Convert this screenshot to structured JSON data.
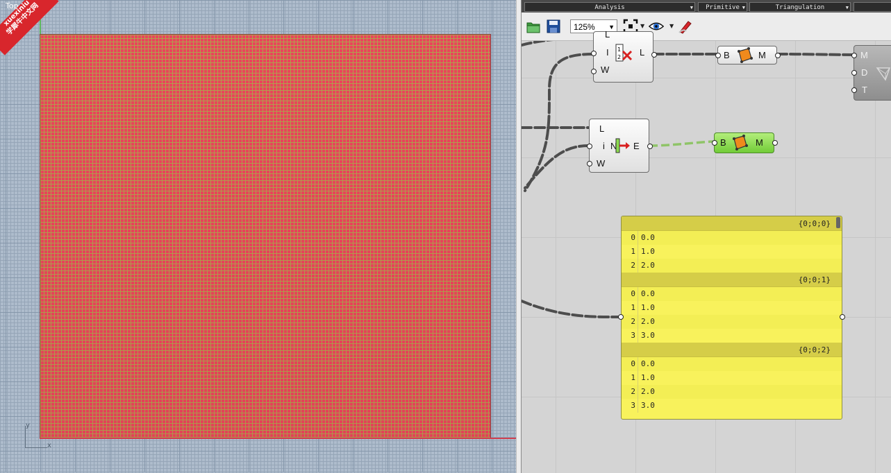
{
  "viewport": {
    "title": "Top",
    "axis_x": "x",
    "axis_y": "y",
    "watermark_line1": "xuexiniu",
    "watermark_line2": "学犀牛中文网"
  },
  "tabs": [
    {
      "label": "Analysis"
    },
    {
      "label": "Primitive"
    },
    {
      "label": "Triangulation"
    }
  ],
  "toolbar": {
    "zoom": "125%",
    "open_icon": "folder-open-icon",
    "save_icon": "save-icon",
    "zoom_extents_icon": "zoom-extents-icon",
    "preview_icon": "eye-icon",
    "sketch_icon": "pen-icon"
  },
  "components": {
    "list_item": {
      "in": [
        "L",
        "I",
        "W"
      ],
      "out": "L"
    },
    "boundary_top": {
      "in": "B",
      "out": "M"
    },
    "delaunay": {
      "in": [
        "M",
        "D",
        "T"
      ]
    },
    "member_index": {
      "in": [
        "L",
        "i",
        "W"
      ],
      "icon_text": "N",
      "out": "E"
    },
    "boundary_green": {
      "in": "B",
      "out": "M"
    }
  },
  "panel": {
    "branches": [
      {
        "path": "{0;0;0}",
        "items": [
          {
            "i": "0",
            "v": "0.0"
          },
          {
            "i": "1",
            "v": "1.0"
          },
          {
            "i": "2",
            "v": "2.0"
          }
        ]
      },
      {
        "path": "{0;0;1}",
        "items": [
          {
            "i": "0",
            "v": "0.0"
          },
          {
            "i": "1",
            "v": "1.0"
          },
          {
            "i": "2",
            "v": "2.0"
          },
          {
            "i": "3",
            "v": "3.0"
          }
        ]
      },
      {
        "path": "{0;0;2}",
        "items": [
          {
            "i": "0",
            "v": "0.0"
          },
          {
            "i": "1",
            "v": "1.0"
          },
          {
            "i": "2",
            "v": "2.0"
          },
          {
            "i": "3",
            "v": "3.0"
          }
        ]
      }
    ]
  },
  "colors": {
    "mesh_face": "#e8455c",
    "mesh_edge": "#a9a94d",
    "panel_bg": "#f8f25c",
    "selected_component": "#8ddb4f"
  }
}
